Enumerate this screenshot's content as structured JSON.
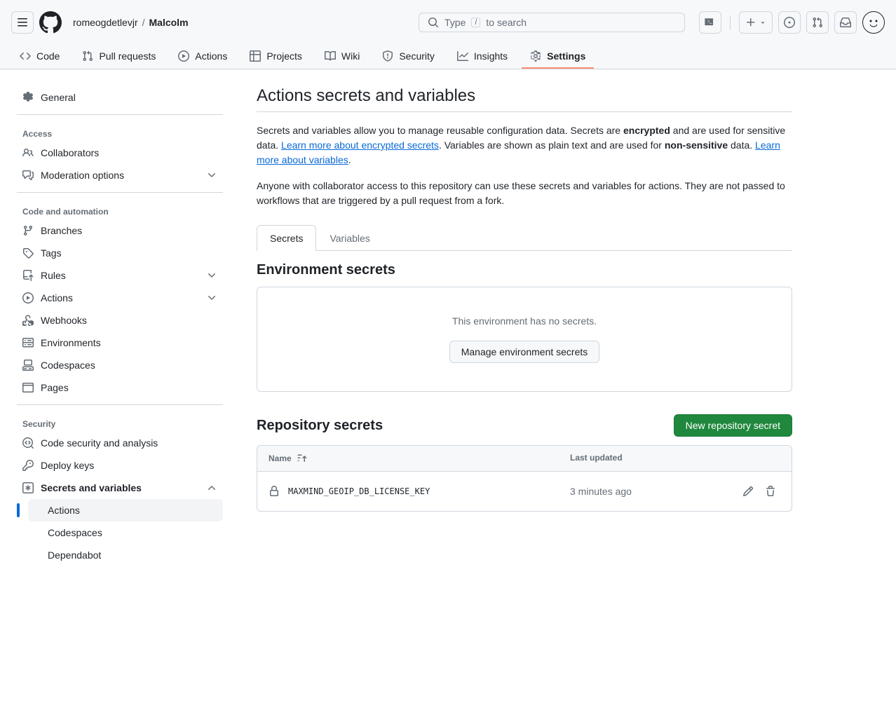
{
  "header": {
    "owner": "romeogdetlevjr",
    "repo": "Malcolm",
    "search_placeholder_pre": "Type",
    "search_placeholder_post": "to search",
    "search_kbd": "/"
  },
  "repo_tabs": {
    "code": "Code",
    "pulls": "Pull requests",
    "actions": "Actions",
    "projects": "Projects",
    "wiki": "Wiki",
    "security": "Security",
    "insights": "Insights",
    "settings": "Settings"
  },
  "sidebar": {
    "general": "General",
    "access_heading": "Access",
    "collaborators": "Collaborators",
    "moderation": "Moderation options",
    "code_heading": "Code and automation",
    "branches": "Branches",
    "tags": "Tags",
    "rules": "Rules",
    "actions": "Actions",
    "webhooks": "Webhooks",
    "environments": "Environments",
    "codespaces": "Codespaces",
    "pages": "Pages",
    "security_heading": "Security",
    "code_security": "Code security and analysis",
    "deploy_keys": "Deploy keys",
    "secrets_vars": "Secrets and variables",
    "sub_actions": "Actions",
    "sub_codespaces": "Codespaces",
    "sub_dependabot": "Dependabot"
  },
  "content": {
    "title": "Actions secrets and variables",
    "intro1_a": "Secrets and variables allow you to manage reusable configuration data. Secrets are ",
    "intro1_b": "encrypted",
    "intro1_c": " and are used for sensitive data. ",
    "link_secrets": "Learn more about encrypted secrets",
    "intro1_d": ". Variables are shown as plain text and are used for ",
    "intro1_e": "non-sensitive",
    "intro1_f": " data. ",
    "link_vars": "Learn more about variables",
    "intro1_g": ".",
    "intro2": "Anyone with collaborator access to this repository can use these secrets and variables for actions. They are not passed to workflows that are triggered by a pull request from a fork.",
    "tab_secrets": "Secrets",
    "tab_variables": "Variables",
    "env_title": "Environment secrets",
    "env_empty": "This environment has no secrets.",
    "manage_env_btn": "Manage environment secrets",
    "repo_secrets_title": "Repository secrets",
    "new_secret_btn": "New repository secret",
    "col_name": "Name",
    "col_updated": "Last updated",
    "secrets": [
      {
        "name": "MAXMIND_GEOIP_DB_LICENSE_KEY",
        "updated": "3 minutes ago"
      }
    ]
  }
}
